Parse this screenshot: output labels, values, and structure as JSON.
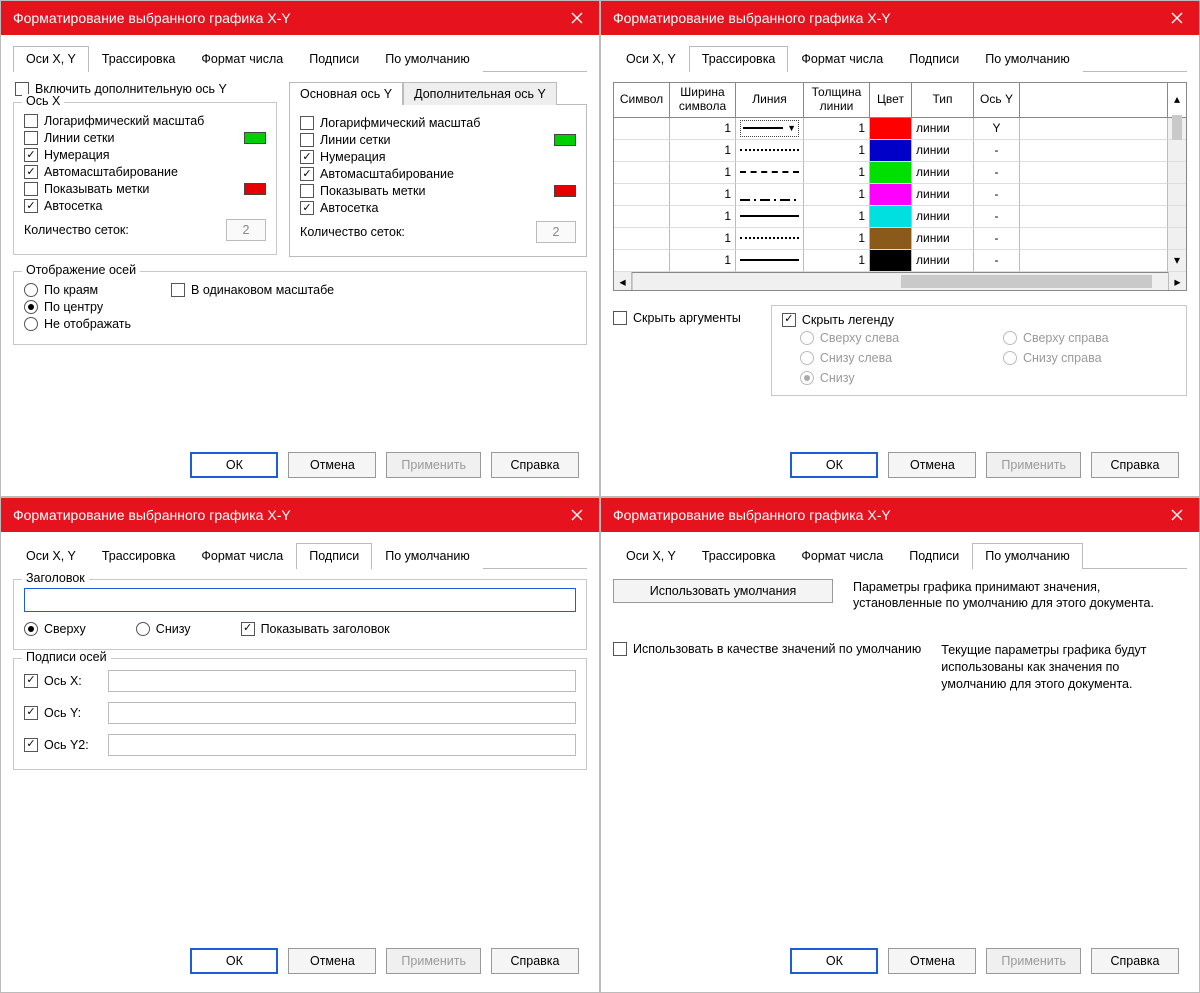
{
  "title": "Форматирование выбранного графика X-Y",
  "tabs": {
    "axes": "Оси X, Y",
    "trace": "Трассировка",
    "numfmt": "Формат числа",
    "labels": "Подписи",
    "defaults": "По умолчанию"
  },
  "buttons": {
    "ok": "ОК",
    "cancel": "Отмена",
    "apply": "Применить",
    "help": "Справка"
  },
  "d1": {
    "enable_sec_y": "Включить дополнительную ось Y",
    "group_x": "Ось X",
    "group_y_main": "Основная ось Y",
    "group_y_sec": "Дополнительная ось Y",
    "opt": {
      "log": "Логарифмический масштаб",
      "grid": "Линии сетки",
      "number": "Нумерация",
      "autoscale": "Автомасштабирование",
      "show_marks": "Показывать метки",
      "autogrid": "Автосетка",
      "grid_count": "Количество сеток:"
    },
    "grid_count_val": "2",
    "axis_display": {
      "legend": "Отображение осей",
      "edges": "По краям",
      "center": "По центру",
      "none": "Не отображать",
      "same_scale": "В одинаковом масштабе"
    },
    "grid_color": "#00d000",
    "marks_color": "#e60000"
  },
  "d2": {
    "headers": {
      "symbol": "Символ",
      "symwidth": "Ширина символа",
      "line": "Линия",
      "thickness": "Толщина линии",
      "color": "Цвет",
      "type": "Тип",
      "axisy": "Ось Y"
    },
    "rows": [
      {
        "w": "1",
        "line": "solid",
        "combo": true,
        "th": "1",
        "color": "#ff0000",
        "type": "линии",
        "axis": "Y"
      },
      {
        "w": "1",
        "line": "dotted",
        "th": "1",
        "color": "#0000c8",
        "type": "линии",
        "axis": "-"
      },
      {
        "w": "1",
        "line": "dashed",
        "th": "1",
        "color": "#00e000",
        "type": "линии",
        "axis": "-"
      },
      {
        "w": "1",
        "line": "dashdot",
        "th": "1",
        "color": "#ff00ff",
        "type": "линии",
        "axis": "-"
      },
      {
        "w": "1",
        "line": "solid",
        "th": "1",
        "color": "#00e0e0",
        "type": "линии",
        "axis": "-"
      },
      {
        "w": "1",
        "line": "dotted",
        "th": "1",
        "color": "#8b5a1a",
        "type": "линии",
        "axis": "-"
      },
      {
        "w": "1",
        "line": "solid",
        "th": "1",
        "color": "#000000",
        "type": "линии",
        "axis": "-"
      }
    ],
    "hide_args": "Скрыть аргументы",
    "hide_legend": "Скрыть легенду",
    "legend_pos": {
      "tl": "Сверху слева",
      "tr": "Сверху справа",
      "bl": "Снизу слева",
      "br": "Снизу справа",
      "b": "Снизу"
    }
  },
  "d3": {
    "title_legend": "Заголовок",
    "pos_top": "Сверху",
    "pos_bottom": "Снизу",
    "show_title": "Показывать заголовок",
    "axis_legend": "Подписи осей",
    "axis_x": "Ось X:",
    "axis_y": "Ось Y:",
    "axis_y2": "Ось Y2:"
  },
  "d4": {
    "use_defaults_btn": "Использовать умолчания",
    "use_defaults_desc": "Параметры графика принимают значения, установленные по умолчанию для этого документа.",
    "use_as_defaults": "Использовать в качестве значений по умолчанию",
    "use_as_defaults_desc": "Текущие параметры графика будут использованы как значения по умолчанию для этого документа."
  }
}
